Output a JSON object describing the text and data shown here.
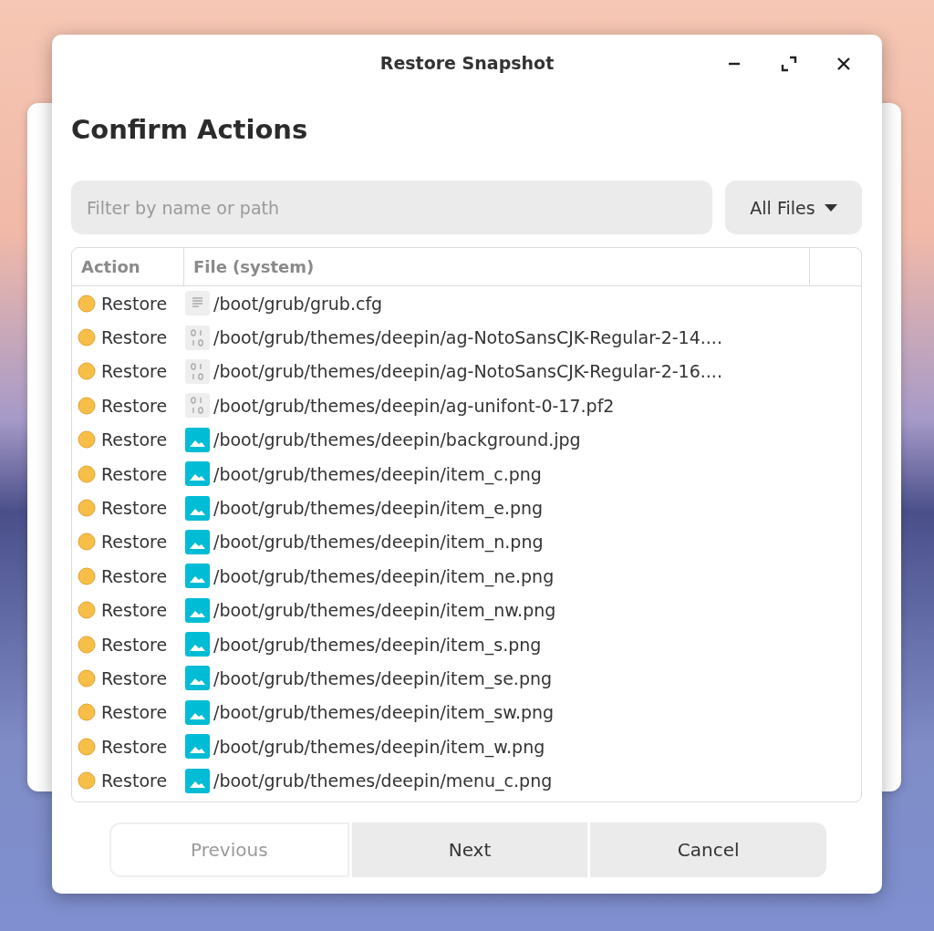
{
  "window": {
    "title": "Restore Snapshot"
  },
  "heading": "Confirm Actions",
  "filter": {
    "placeholder": "Filter by name or path"
  },
  "file_type": {
    "value": "All Files"
  },
  "table": {
    "columns": [
      "Action",
      "File (system)"
    ],
    "rows": [
      {
        "action": "Restore",
        "kind": "text",
        "path": "/boot/grub/grub.cfg"
      },
      {
        "action": "Restore",
        "kind": "binary",
        "path": "/boot/grub/themes/deepin/ag-NotoSansCJK-Regular-2-14...."
      },
      {
        "action": "Restore",
        "kind": "binary",
        "path": "/boot/grub/themes/deepin/ag-NotoSansCJK-Regular-2-16...."
      },
      {
        "action": "Restore",
        "kind": "binary",
        "path": "/boot/grub/themes/deepin/ag-unifont-0-17.pf2"
      },
      {
        "action": "Restore",
        "kind": "image",
        "path": "/boot/grub/themes/deepin/background.jpg"
      },
      {
        "action": "Restore",
        "kind": "image",
        "path": "/boot/grub/themes/deepin/item_c.png"
      },
      {
        "action": "Restore",
        "kind": "image",
        "path": "/boot/grub/themes/deepin/item_e.png"
      },
      {
        "action": "Restore",
        "kind": "image",
        "path": "/boot/grub/themes/deepin/item_n.png"
      },
      {
        "action": "Restore",
        "kind": "image",
        "path": "/boot/grub/themes/deepin/item_ne.png"
      },
      {
        "action": "Restore",
        "kind": "image",
        "path": "/boot/grub/themes/deepin/item_nw.png"
      },
      {
        "action": "Restore",
        "kind": "image",
        "path": "/boot/grub/themes/deepin/item_s.png"
      },
      {
        "action": "Restore",
        "kind": "image",
        "path": "/boot/grub/themes/deepin/item_se.png"
      },
      {
        "action": "Restore",
        "kind": "image",
        "path": "/boot/grub/themes/deepin/item_sw.png"
      },
      {
        "action": "Restore",
        "kind": "image",
        "path": "/boot/grub/themes/deepin/item_w.png"
      },
      {
        "action": "Restore",
        "kind": "image",
        "path": "/boot/grub/themes/deepin/menu_c.png"
      }
    ]
  },
  "buttons": [
    {
      "label": "Previous",
      "disabled": true
    },
    {
      "label": "Next",
      "disabled": false
    },
    {
      "label": "Cancel",
      "disabled": false
    }
  ]
}
